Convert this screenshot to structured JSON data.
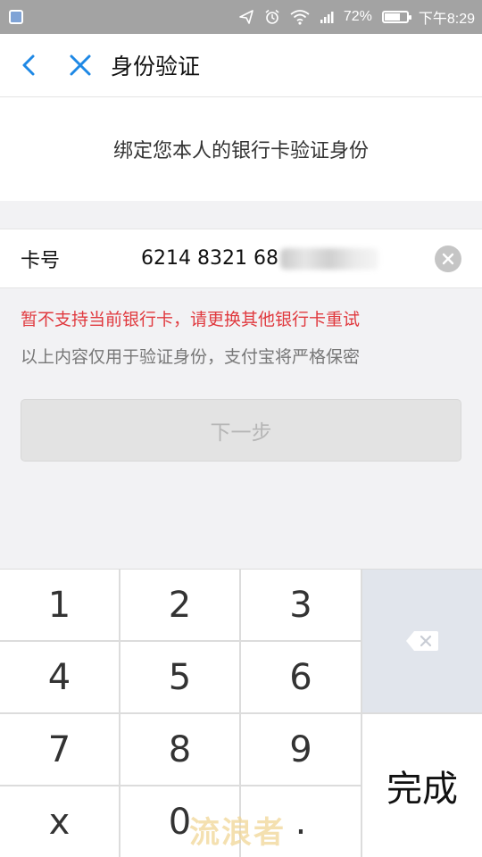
{
  "status_bar": {
    "battery_percent": "72%",
    "battery_level": 0.72,
    "time": "下午8:29"
  },
  "nav": {
    "title": "身份验证",
    "back_icon": "chevron-left-icon",
    "close_icon": "close-icon"
  },
  "header": {
    "text": "绑定您本人的银行卡验证身份"
  },
  "card_field": {
    "label": "卡号",
    "value": "6214 8321 68"
  },
  "error_message": "暂不支持当前银行卡，请更换其他银行卡重试",
  "info_message": "以上内容仅用于验证身份，支付宝将严格保密",
  "next_button": "下一步",
  "keypad": {
    "keys": [
      "1",
      "2",
      "3",
      "4",
      "5",
      "6",
      "7",
      "8",
      "9",
      "x",
      "0",
      "."
    ],
    "done_label": "完成",
    "delete_icon": "backspace-icon"
  },
  "watermark": "流浪者",
  "colors": {
    "accent": "#1e88e5",
    "error": "#e0393e",
    "status_bar": "#a3a3a3"
  }
}
